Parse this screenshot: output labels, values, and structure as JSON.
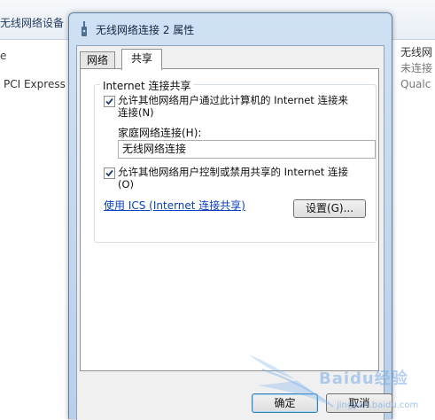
{
  "background_window": {
    "title": "无线网络设备",
    "left_line": "e",
    "adapter_name": "PCI Express",
    "right_items": [
      "无线网",
      "未连接",
      "Qualc"
    ]
  },
  "dialog": {
    "title": "无线网络连接 2 属性",
    "tabs": [
      {
        "label": "网络",
        "active": false
      },
      {
        "label": "共享",
        "active": true
      }
    ],
    "group_label": "Internet 连接共享",
    "allow_connect_checkbox": {
      "checked": true,
      "label": "允许其他网络用户通过此计算机的 Internet 连接来连接(N)"
    },
    "home_network_label": "家庭网络连接(H):",
    "home_network_value": "无线网络连接",
    "allow_control_checkbox": {
      "checked": true,
      "label": "允许其他网络用户控制或禁用共享的 Internet 连接(O)"
    },
    "ics_link": "使用 ICS (Internet 连接共享)",
    "settings_button": "设置(G)...",
    "ok_button": "确定",
    "cancel_button": "取消"
  },
  "watermark": {
    "text": "Baidu经验",
    "url": "jingyan.baidu.com"
  }
}
